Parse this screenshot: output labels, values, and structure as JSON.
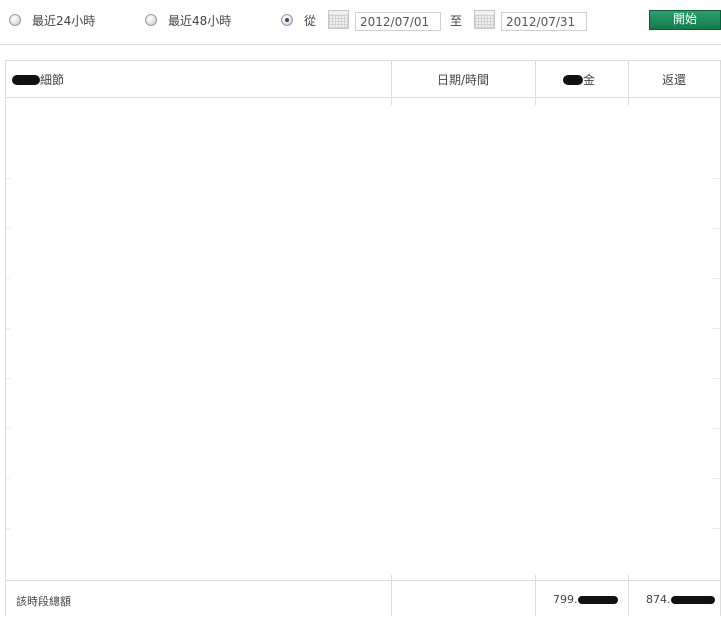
{
  "filter": {
    "option_24h": "最近24小時",
    "option_48h": "最近48小時",
    "option_range": "從",
    "range_to": "至",
    "start_date": "2012/07/01",
    "end_date": "2012/07/31",
    "start_button": "開始",
    "selected": "range"
  },
  "table": {
    "columns": {
      "details": "細節",
      "datetime": "日期/時間",
      "amount": "金",
      "return": "返還"
    },
    "rows": []
  },
  "footer": {
    "total_label": "該時段總額",
    "amount_total": "799.",
    "return_total": "874."
  },
  "colors": {
    "button": "#1f8a5b",
    "border": "#dcdcdc"
  }
}
